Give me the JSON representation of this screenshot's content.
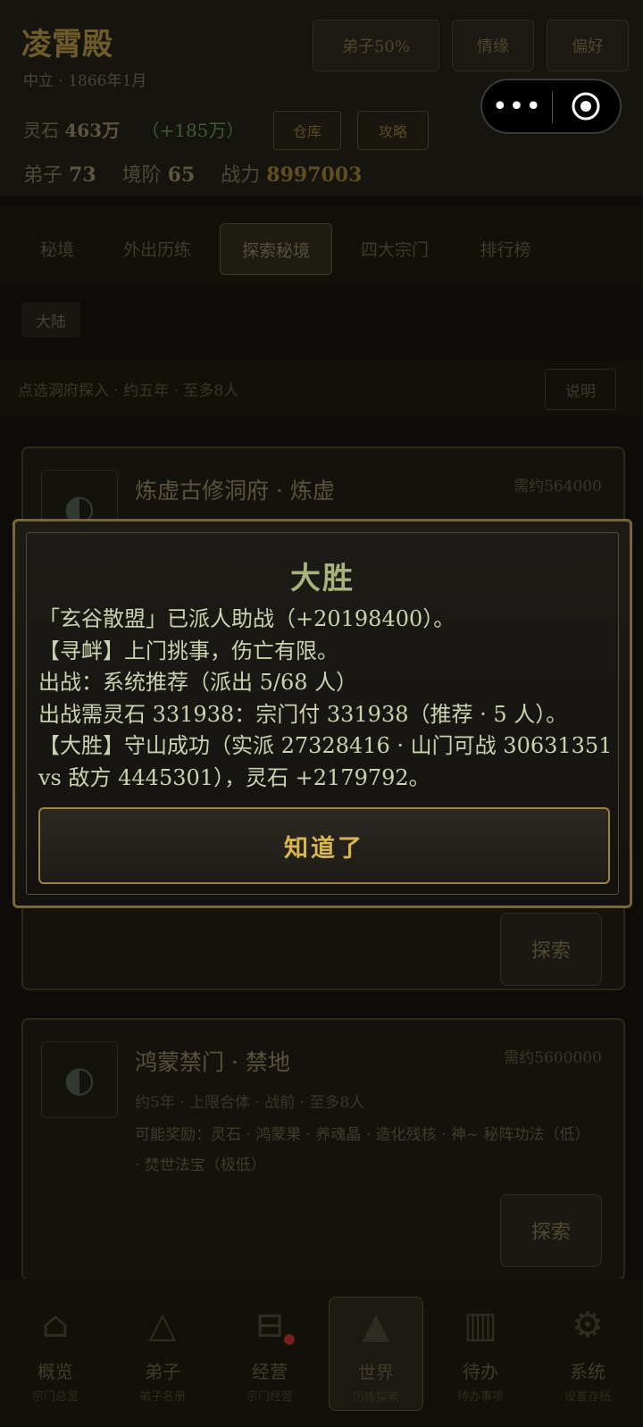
{
  "header": {
    "title": "凌霄殿",
    "subtitle": "中立 · 1866年1月",
    "buttons": [
      "弟子50%",
      "情缘",
      "偏好"
    ],
    "lingshi_label": "灵石",
    "lingshi_value": "463万",
    "lingshi_gain": "（+185万）",
    "small_buttons": [
      "仓库",
      "攻略"
    ],
    "disciples_label": "弟子",
    "disciples_value": "73",
    "tier_label": "境阶",
    "tier_value": "65",
    "power_label": "战力",
    "power_value": "8997003"
  },
  "tabs": [
    "秘境",
    "外出历练",
    "探索秘境",
    "四大宗门",
    "排行榜"
  ],
  "active_tab": 2,
  "chip": "大陆",
  "info_row": {
    "text": "点选洞府探入 · 约五年 · 至多8人",
    "explain": "说明"
  },
  "cards": [
    {
      "title": "炼虚古修洞府 · 炼虚",
      "badge": "需约564000",
      "explore": "探索"
    },
    {
      "title": "鸿蒙禁门 · 禁地",
      "badge": "需约5600000",
      "meta": "约5年 · 上限合体 · 战前 · 至多8人",
      "desc": "可能奖励：灵石 · 鸿蒙果 · 养魂晶 · 造化残核 · 神~ 秘阵功法（低） · 焚世法宝（极低）",
      "explore": "探索"
    }
  ],
  "bottom_nav": [
    {
      "label": "概览",
      "sub": "宗门总览",
      "icon": "hall-icon"
    },
    {
      "label": "弟子",
      "sub": "弟子名册",
      "icon": "disciple-icon"
    },
    {
      "label": "经营",
      "sub": "宗门经营",
      "icon": "manage-icon",
      "dot": true
    },
    {
      "label": "世界",
      "sub": "历练探索",
      "icon": "world-icon",
      "active": true
    },
    {
      "label": "待办",
      "sub": "待办事项",
      "icon": "todo-icon"
    },
    {
      "label": "系统",
      "sub": "设置存档",
      "icon": "system-icon"
    }
  ],
  "capsule": {
    "more": "•••"
  },
  "modal": {
    "title": "大胜",
    "lines": [
      "「玄谷散盟」已派人助战（+20198400）。",
      "【寻衅】上门挑事，伤亡有限。",
      "出战：系统推荐（派出 5/68 人）",
      "出战需灵石 331938：宗门付 331938（推荐 · 5 人）。",
      "【大胜】守山成功（实派 27328416 · 山门可战 30631351",
      "vs 敌方 4445301），灵石 +2179792。"
    ],
    "ok_label": "知道了"
  }
}
